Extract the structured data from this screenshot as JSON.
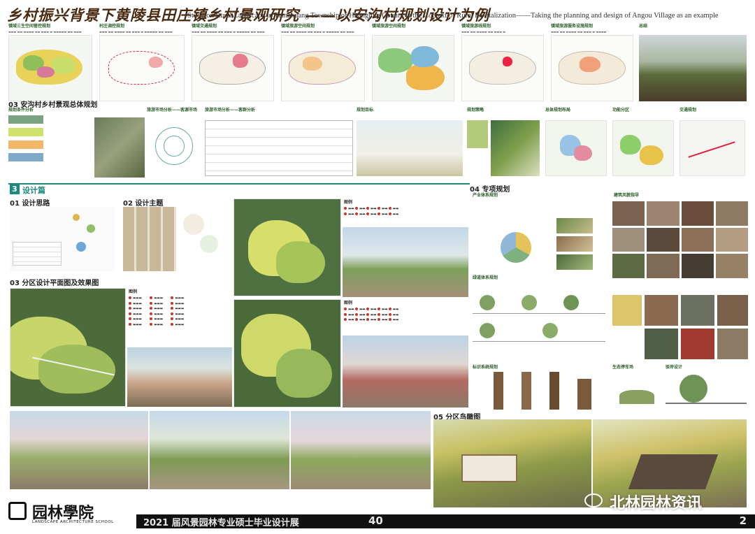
{
  "header": {
    "title_cn": "乡村振兴背景下黄陵县田庄镇乡村景观研究 ——以安沟村规划设计为例",
    "title_en": "Study on Rural Landscape in Tianzhuang Township of Huangling County in the Context of Rural Revitalization——Taking the planning and design of Angou Village as an example"
  },
  "row1_panels": [
    {
      "title": "镇域三生空间管控规划"
    },
    {
      "title": "村庄调控规划"
    },
    {
      "title": "镇域交通规划"
    },
    {
      "title": "镇域旅游空间规划"
    },
    {
      "title": "镇域旅游线规划"
    },
    {
      "title": "镇域旅游服务设施规划"
    },
    {
      "title": "总结"
    }
  ],
  "row2": {
    "section_title": "03 安沟村乡村景观总体规划",
    "sub_title": "规划条件分析",
    "panels": [
      {
        "title": "旅游市场分析——客源市场"
      },
      {
        "title": "旅游市场分析——客群分析"
      },
      {
        "title": "规划目标"
      },
      {
        "title": "规划策略"
      },
      {
        "title": "总体规划布局"
      },
      {
        "title": "功能分区"
      },
      {
        "title": "交通规划"
      }
    ]
  },
  "design": {
    "chapter": "设计篇",
    "chapter_num": "3",
    "s01": "01 设计思路",
    "s02": "02 设计主题",
    "s03": "03 分区设计平面图及效果图",
    "s04": "04 专项规划",
    "s05": "05 分区鸟瞰图",
    "legend_title": "图例",
    "plans": {
      "industry": "产业体系规划",
      "building": "建筑风貌指导",
      "greenway": "绿道体系规划",
      "signage": "标识系统规划",
      "parking": "生态停车场",
      "wall": "驳岸设计"
    }
  },
  "footer": {
    "logo_text": "园林學院",
    "logo_sub": "LANDSCAPE ARCHITECTURE SCHOOL",
    "exhibition": "2021 届风景园林专业硕士毕业设计展",
    "number": "40",
    "watermark": "北林园林资讯",
    "page": "2"
  },
  "colors": {
    "green": "#2a5e2a",
    "teal": "#1d8a7d",
    "map_yellow": "#e8d25a",
    "map_pink": "#d77a9a",
    "dark": "#111111"
  }
}
